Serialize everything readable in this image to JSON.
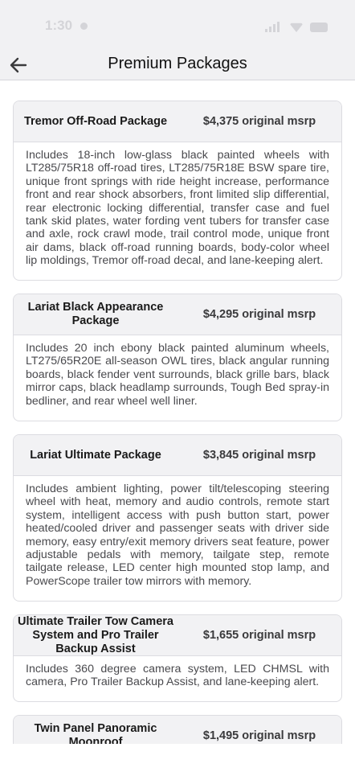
{
  "status_bar": {
    "time": "1:30"
  },
  "header": {
    "title": "Premium Packages"
  },
  "packages": [
    {
      "name": "Tremor Off-Road Package",
      "price": "$4,375 original msrp",
      "description": "Includes 18-inch low-glass black painted wheels with LT285/75R18 off-road tires, LT285/75R18E BSW spare tire, unique front springs with ride height increase, performance front and rear shock absorbers, front limited slip differential, rear electronic locking differential, transfer case and fuel tank skid plates, water fording vent tubers for transfer case and axle, rock crawl mode, trail control mode, unique front air dams, black off-road running boards, body-color wheel lip moldings, Tremor off-road decal, and lane-keeping alert."
    },
    {
      "name": "Lariat Black Appearance Package",
      "price": "$4,295 original msrp",
      "description": "Includes 20 inch ebony black painted aluminum wheels, LT275/65R20E all-season OWL tires, black angular running boards, black fender vent surrounds, black grille bars, black mirror caps, black headlamp surrounds, Tough Bed spray-in bedliner, and rear wheel well liner."
    },
    {
      "name": "Lariat Ultimate Package",
      "price": "$3,845 original msrp",
      "description": "Includes ambient lighting, power tilt/telescoping steering wheel with heat, memory and audio controls, remote start system, intelligent access with push button start, power heated/cooled driver and passenger seats with driver side memory, easy entry/exit memory drivers seat feature, power adjustable pedals with memory, tailgate step, remote tailgate release, LED center high mounted stop lamp, and PowerScope trailer tow mirrors with memory."
    },
    {
      "name": "Ultimate Trailer Tow Camera System and Pro Trailer Backup Assist",
      "price": "$1,655 original msrp",
      "description": "Includes 360 degree camera system, LED CHMSL with camera, Pro Trailer Backup Assist, and lane-keeping alert."
    },
    {
      "name": "Twin Panel Panoramic Moonroof",
      "price": "$1,495 original msrp",
      "description": ""
    }
  ]
}
